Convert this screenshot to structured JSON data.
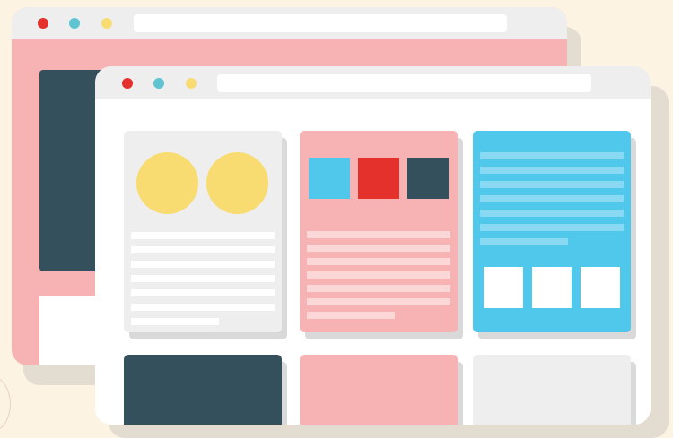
{
  "colors": {
    "background": "#fdf3e3",
    "back_window_body": "#f7b3b3",
    "toolbar": "#eeeeef",
    "front_window_body": "#ffffff",
    "dot_red": "#e4312c",
    "dot_teal": "#5ec4d2",
    "dot_yellow": "#f8dc72",
    "dark_slate": "#33505c",
    "pink": "#f7b3b3",
    "sky_blue": "#4fc8eb",
    "light_gray": "#eeeeef",
    "shadow": "#d9d9d9"
  },
  "icons": [
    "close-dot",
    "minimize-dot",
    "maximize-dot",
    "circle-image",
    "square-image"
  ]
}
